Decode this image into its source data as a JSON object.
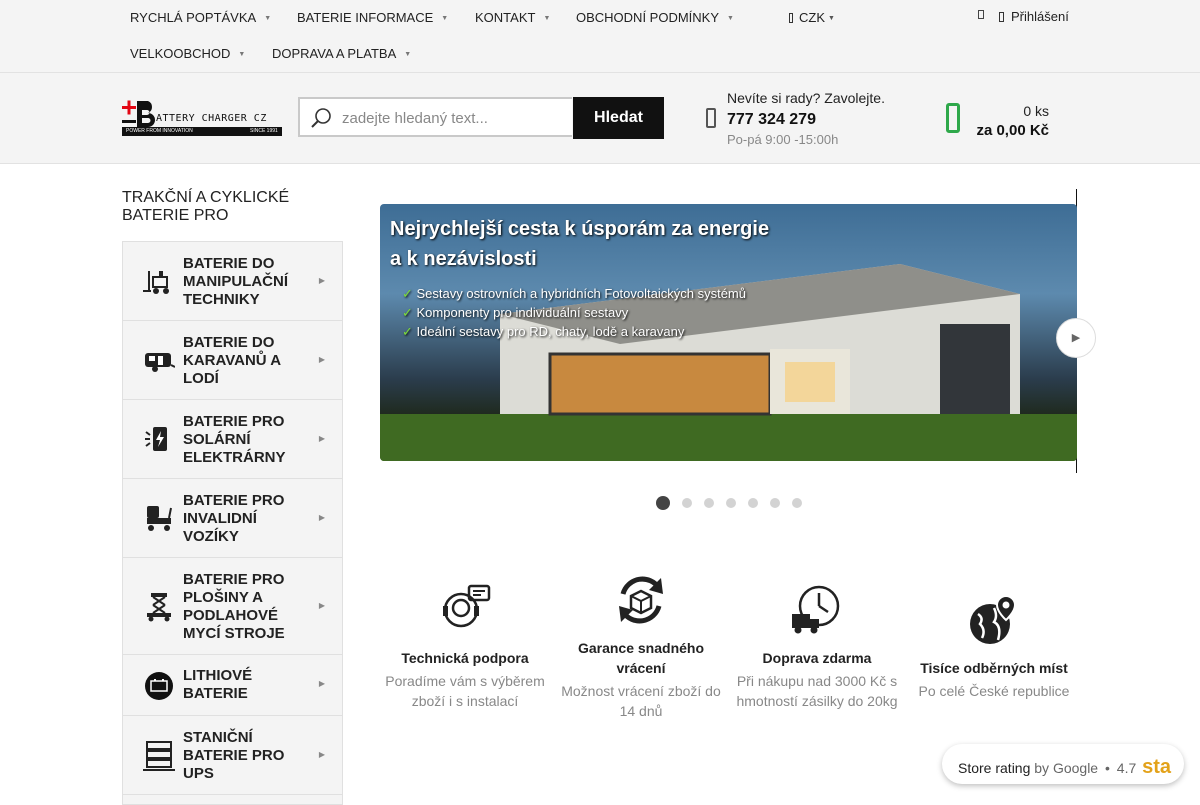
{
  "topnav": {
    "items": [
      {
        "label": "RYCHLÁ POPTÁVKA"
      },
      {
        "label": "BATERIE INFORMACE"
      },
      {
        "label": "KONTAKT"
      },
      {
        "label": "OBCHODNÍ PODMÍNKY"
      },
      {
        "label": "VELKOOBCHOD"
      },
      {
        "label": "DOPRAVA A PLATBA"
      }
    ],
    "currency_label": "CZK",
    "login_label": "Přihlášení"
  },
  "header": {
    "logo_text": "ATTERY CHARGER CZ",
    "logo_tagline": "POWER FROM INNOVATION",
    "logo_since": "SINCE 1991",
    "search_placeholder": "zadejte hledaný text...",
    "search_button": "Hledat",
    "phone_prompt": "Nevíte si rady? Zavolejte.",
    "phone_number": "777 324 279",
    "phone_hours": "Po-pá 9:00 -15:00h",
    "cart_count": "0 ks",
    "cart_total": "za 0,00 Kč"
  },
  "sidebar": {
    "title": "TRAKČNÍ A CYKLICKÉ BATERIE PRO",
    "items": [
      {
        "label": "BATERIE DO MANIPULAČNÍ TECHNIKY",
        "icon": "forklift-icon"
      },
      {
        "label": "BATERIE DO KARAVANŮ A LODÍ",
        "icon": "caravan-icon"
      },
      {
        "label": "BATERIE PRO SOLÁRNÍ ELEKTRÁRNY",
        "icon": "solar-battery-icon"
      },
      {
        "label": "BATERIE PRO INVALIDNÍ VOZÍKY",
        "icon": "mobility-scooter-icon"
      },
      {
        "label": "BATERIE PRO PLOŠINY A PODLAHOVÉ MYCÍ STROJE",
        "icon": "scissor-lift-icon"
      },
      {
        "label": "LITHIOVÉ BATERIE",
        "icon": "lithium-battery-icon"
      },
      {
        "label": "STANIČNÍ BATERIE PRO UPS",
        "icon": "ups-battery-icon"
      }
    ]
  },
  "slider": {
    "heading_line1": "Nejrychlejší cesta k úsporám za energie",
    "heading_line2": "a k nezávislosti",
    "bullets": [
      "Sestavy ostrovních a hybridních Fotovoltaických systémů",
      "Komponenty pro individuální sestavy",
      "Ideální sestavy pro RD, chaty, lodě a karavany"
    ],
    "slide_count": 7,
    "active_slide": 1
  },
  "features": [
    {
      "title": "Technická podpora",
      "desc": "Poradíme vám s výběrem zboží i s instalací",
      "icon": "support-headset-icon"
    },
    {
      "title": "Garance snadného vrácení",
      "desc": "Možnost vrácení zboží do 14 dnů",
      "icon": "return-box-icon"
    },
    {
      "title": "Doprava zdarma",
      "desc": "Při nákupu nad 3000 Kč s hmotností zásilky do 20kg",
      "icon": "delivery-truck-clock-icon"
    },
    {
      "title": "Tisíce odběrných míst",
      "desc": "Po celé České republice",
      "icon": "globe-pin-icon"
    }
  ],
  "rating": {
    "label": "Store rating",
    "by": "by Google",
    "score": "4.7",
    "stars_partial": "sta"
  },
  "colors": {
    "accent_green": "#2ea84a",
    "logo_red": "#e30613",
    "dark": "#111111"
  }
}
